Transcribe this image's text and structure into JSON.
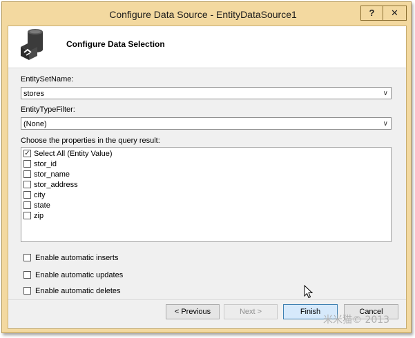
{
  "window": {
    "title": "Configure Data Source - EntityDataSource1",
    "help_label": "?",
    "close_label": "✕"
  },
  "header": {
    "title": "Configure Data Selection",
    "icon": "database-refresh-icon"
  },
  "entity_set": {
    "label": "EntitySetName:",
    "value": "stores"
  },
  "entity_type_filter": {
    "label": "EntityTypeFilter:",
    "value": "(None)"
  },
  "properties": {
    "label": "Choose the properties in the query result:",
    "items": [
      {
        "label": "Select All (Entity Value)",
        "checked": true
      },
      {
        "label": "stor_id",
        "checked": false
      },
      {
        "label": "stor_name",
        "checked": false
      },
      {
        "label": "stor_address",
        "checked": false
      },
      {
        "label": "city",
        "checked": false
      },
      {
        "label": "state",
        "checked": false
      },
      {
        "label": "zip",
        "checked": false
      }
    ]
  },
  "options": [
    {
      "label": "Enable automatic inserts",
      "checked": false
    },
    {
      "label": "Enable automatic updates",
      "checked": false
    },
    {
      "label": "Enable automatic deletes",
      "checked": false
    }
  ],
  "buttons": {
    "previous": "< Previous",
    "next": "Next >",
    "finish": "Finish",
    "cancel": "Cancel"
  },
  "watermark": "米米猫© 2013",
  "colors": {
    "frame": "#f3d9a0",
    "client": "#f0f0f0",
    "focus": "#3c7fb1"
  }
}
